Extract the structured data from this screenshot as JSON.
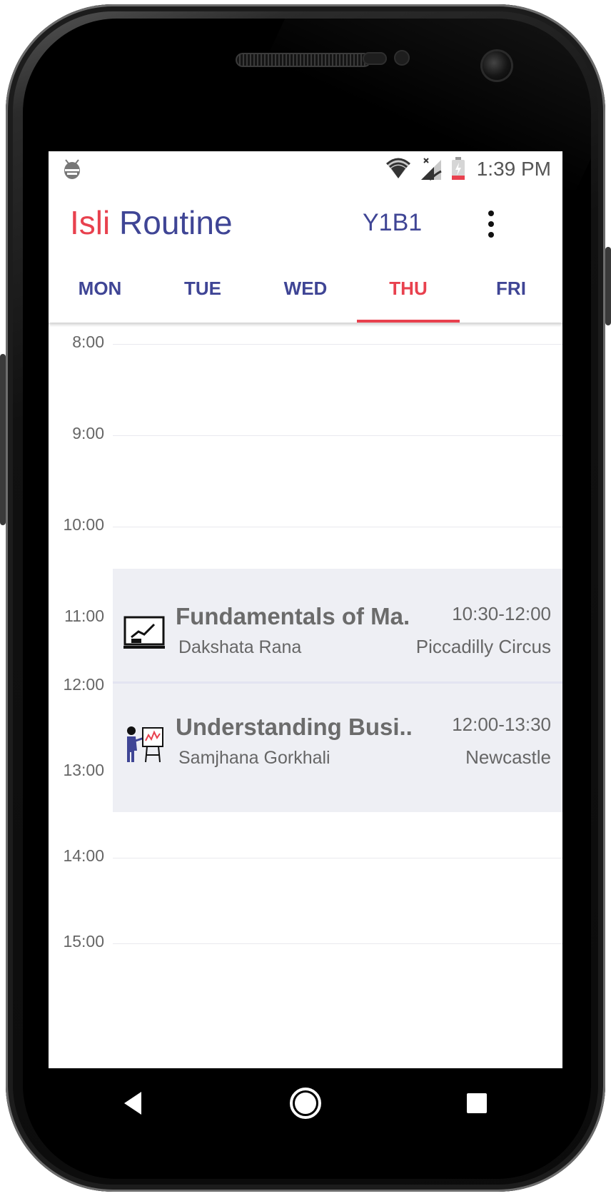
{
  "status_bar": {
    "time": "1:39 PM",
    "icons": [
      "debug-bug-icon",
      "wifi-icon",
      "signal-icon",
      "battery-icon"
    ]
  },
  "app_bar": {
    "title_part1": "Isli",
    "title_part2": "Routine",
    "batch": "Y1B1",
    "menu_icon": "overflow-menu-icon"
  },
  "tabs": [
    {
      "label": "MON",
      "active": false
    },
    {
      "label": "TUE",
      "active": false
    },
    {
      "label": "WED",
      "active": false
    },
    {
      "label": "THU",
      "active": true
    },
    {
      "label": "FRI",
      "active": false
    }
  ],
  "timeline": {
    "hours": [
      "8:00",
      "9:00",
      "10:00",
      "11:00",
      "12:00",
      "13:00",
      "14:00",
      "15:00"
    ]
  },
  "events": [
    {
      "title": "Fundamentals of Ma..",
      "lecturer": "Dakshata Rana",
      "time": "10:30-12:00",
      "room": "Piccadilly Circus",
      "icon": "lecture-board-icon"
    },
    {
      "title": "Understanding Busi..",
      "lecturer": "Samjhana Gorkhali",
      "time": "12:00-13:30",
      "room": "Newcastle",
      "icon": "presenter-icon"
    }
  ],
  "nav": {
    "back_icon": "back-triangle-icon",
    "home_icon": "home-circle-icon",
    "recents_icon": "recents-square-icon"
  },
  "colors": {
    "accent_red": "#e8414e",
    "primary_indigo": "#3f4595",
    "event_background": "#eeeff4"
  }
}
